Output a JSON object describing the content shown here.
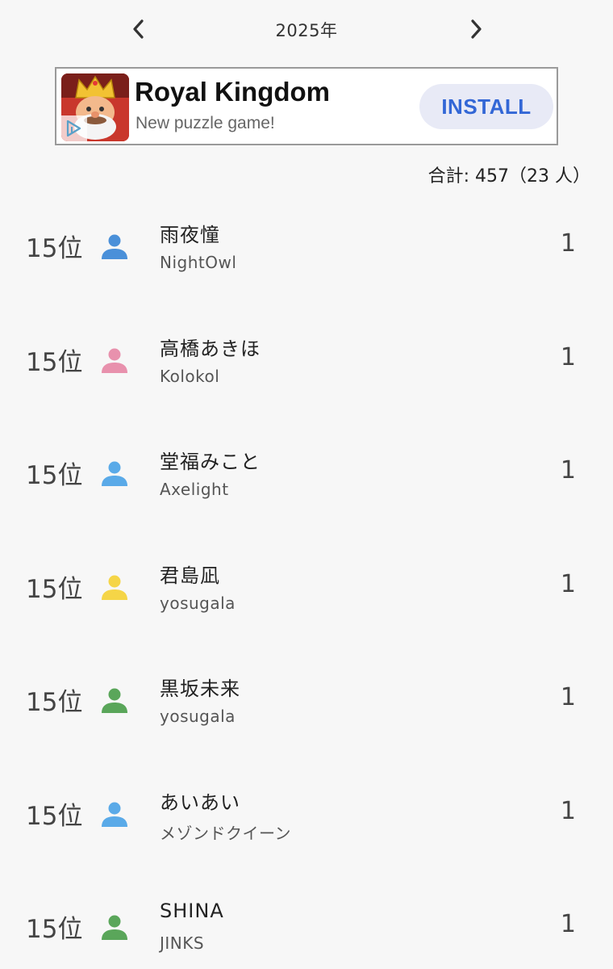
{
  "nav": {
    "year": "2025年",
    "prev_icon": "chevron-left-icon",
    "next_icon": "chevron-right-icon"
  },
  "ad": {
    "title": "Royal Kingdom",
    "subtitle": "New puzzle game!",
    "install_label": "INSTALL",
    "icon": "king-game-icon"
  },
  "summary": {
    "total_text": "合計: 457（23 人）"
  },
  "ranking": [
    {
      "rank": "15位",
      "name": "雨夜憧",
      "sub": "NightOwl",
      "count": "1",
      "icon_color": "#4a90d9"
    },
    {
      "rank": "15位",
      "name": "高橋あきほ",
      "sub": "Kolokol",
      "count": "1",
      "icon_color": "#e891ad"
    },
    {
      "rank": "15位",
      "name": "堂福みこと",
      "sub": "Axelight",
      "count": "1",
      "icon_color": "#5aaae8"
    },
    {
      "rank": "15位",
      "name": "君島凪",
      "sub": "yosugala",
      "count": "1",
      "icon_color": "#f5d547"
    },
    {
      "rank": "15位",
      "name": "黒坂未来",
      "sub": "yosugala",
      "count": "1",
      "icon_color": "#5aa65a"
    },
    {
      "rank": "15位",
      "name": "あいあい",
      "sub": "メゾンドクイーン",
      "count": "1",
      "icon_color": "#5aaae8"
    },
    {
      "rank": "15位",
      "name": "SHINA",
      "sub": "JINKS",
      "count": "1",
      "icon_color": "#5aa65a"
    }
  ]
}
